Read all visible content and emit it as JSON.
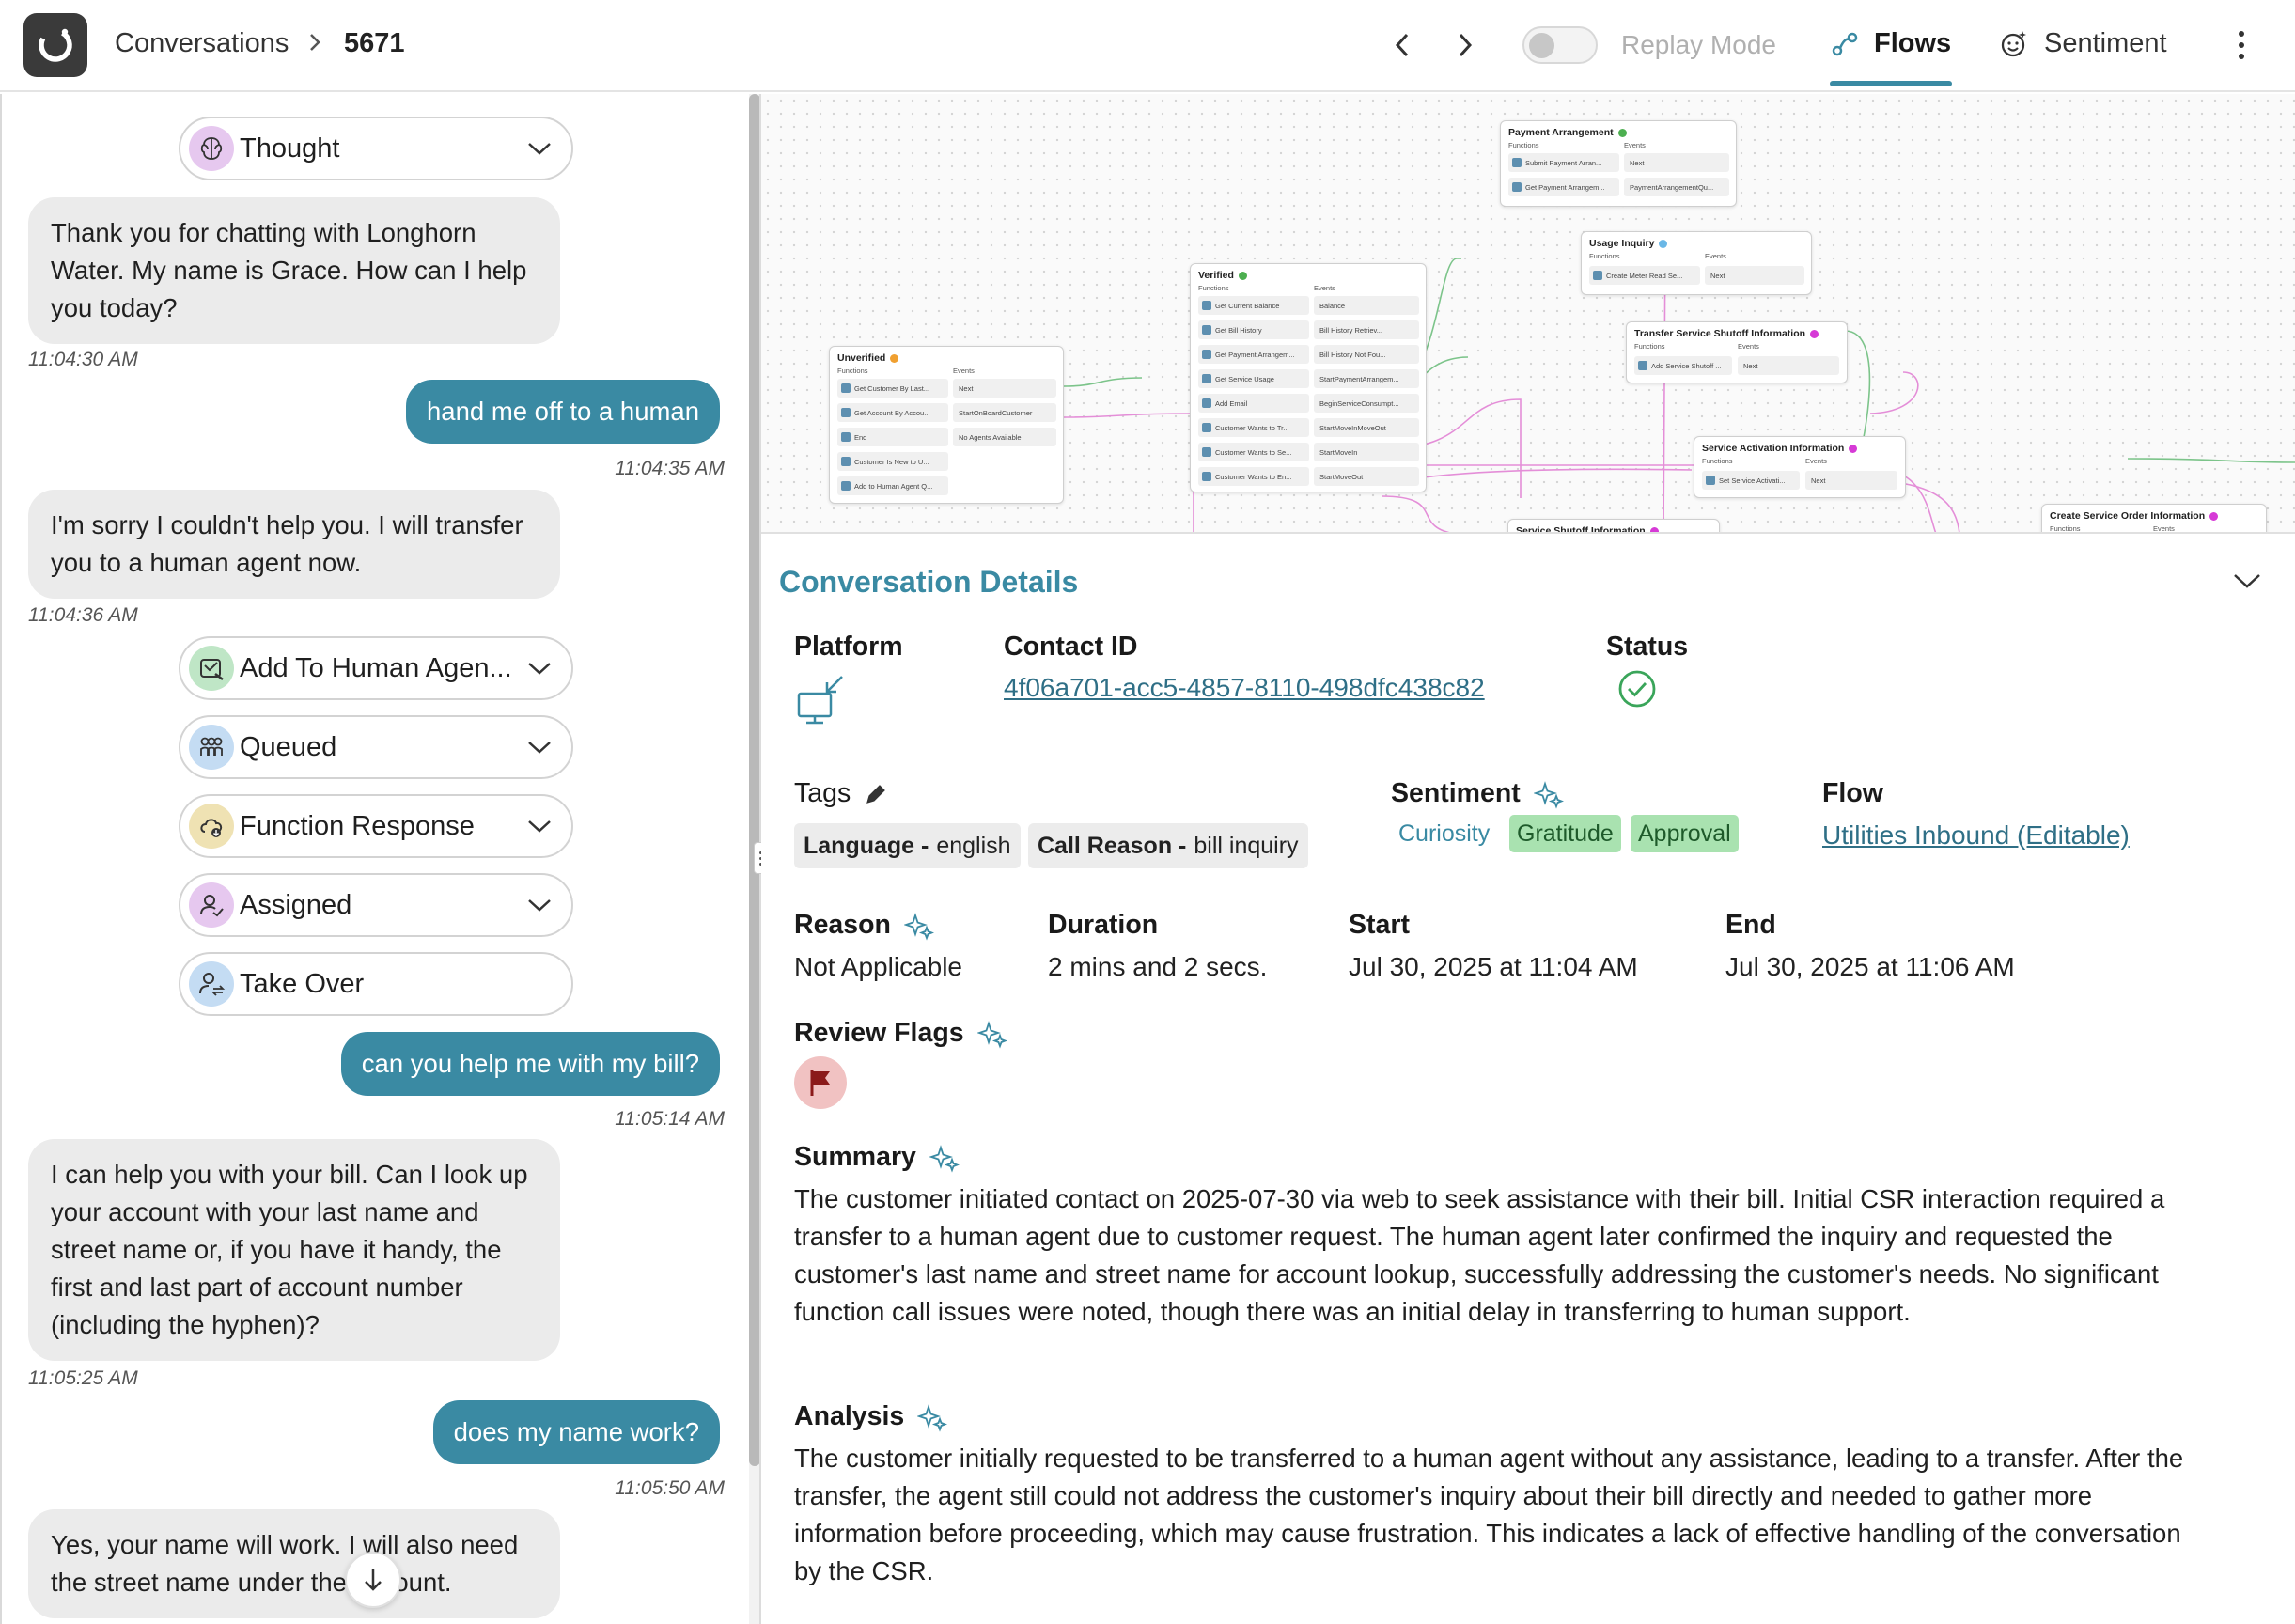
{
  "header": {
    "breadcrumb_root": "Conversations",
    "breadcrumb_id": "5671",
    "replay_label": "Replay Mode",
    "tab_flows": "Flows",
    "tab_sentiment": "Sentiment"
  },
  "chat": {
    "pills": {
      "thought": "Thought",
      "add_to_human": "Add To Human Agen...",
      "queued": "Queued",
      "function_response": "Function Response",
      "assigned": "Assigned",
      "take_over": "Take Over"
    },
    "messages": [
      {
        "role": "bot",
        "text": "Thank you for chatting with Longhorn Water. My name is Grace. How can I help you today?",
        "time": "11:04:30 AM"
      },
      {
        "role": "user",
        "text": "hand me off to a human",
        "time": "11:04:35 AM"
      },
      {
        "role": "bot",
        "text": "I'm sorry I couldn't help you. I will transfer you to a human agent now.",
        "time": "11:04:36 AM"
      },
      {
        "role": "user",
        "text": "can you help me with my bill?",
        "time": "11:05:14 AM"
      },
      {
        "role": "bot",
        "text": "I can help you with your bill. Can I look up your account with your last name and street name or, if you have it handy, the first and last part of account number (including the hyphen)?",
        "time": "11:05:25 AM"
      },
      {
        "role": "user",
        "text": "does my name work?",
        "time": "11:05:50 AM"
      },
      {
        "role": "bot",
        "text": "Yes, your name will work. I will also need the street name under the account.",
        "time": ""
      }
    ]
  },
  "flow": {
    "functions_label": "Functions",
    "events_label": "Events",
    "nodes": {
      "unverified": {
        "title": "Unverified",
        "functions": [
          "Get Customer By Last...",
          "Get Account By Accou...",
          "End",
          "Customer Is New to U...",
          "Add to Human Agent Q..."
        ],
        "events": [
          "Next",
          "StartOnBoardCustomer",
          "No Agents Available"
        ]
      },
      "verified": {
        "title": "Verified",
        "functions": [
          "Get Current Balance",
          "Get Bill History",
          "Get Payment Arrangem...",
          "Get Service Usage",
          "Add Email",
          "Customer Wants to Tr...",
          "Customer Wants to Se...",
          "Customer Wants to En..."
        ],
        "events": [
          "Balance",
          "Bill History Retriev...",
          "Bill History Not Fou...",
          "StartPaymentArrangem...",
          "BeginServiceConsumpt...",
          "StartMoveInMoveOut",
          "StartMoveIn",
          "StartMoveOut"
        ]
      },
      "payment": {
        "title": "Payment Arrangement",
        "functions": [
          "Submit Payment Arran...",
          "Get Payment Arrangem..."
        ],
        "events": [
          "Next",
          "PaymentArrangementQu..."
        ]
      },
      "usage": {
        "title": "Usage Inquiry",
        "functions": [
          "Create Meter Read Se..."
        ],
        "events": [
          "Next"
        ]
      },
      "transfer_shutoff": {
        "title": "Transfer Service Shutoff Information",
        "functions": [
          "Add Service Shutoff ..."
        ],
        "events": [
          "Next"
        ]
      },
      "activation": {
        "title": "Service Activation Information",
        "functions": [
          "Set Service Activati..."
        ],
        "events": [
          "Next"
        ]
      },
      "shutoff": {
        "title": "Service Shutoff Information"
      },
      "create_order": {
        "title": "Create Service Order Information"
      }
    },
    "colors": {
      "unverified": "#f0a030",
      "verified": "#4caf50",
      "payment": "#4caf50",
      "usage": "#6ab7e6",
      "transfer": "#d63ad6",
      "activation": "#d63ad6",
      "edge_green": "#7cc48a",
      "edge_pink": "#e48ed8"
    }
  },
  "details": {
    "title": "Conversation Details",
    "platform_label": "Platform",
    "platform_icon": "web-platform-icon",
    "contact_label": "Contact ID",
    "contact_id": "4f06a701-acc5-4857-8110-498dfc438c82",
    "status_label": "Status",
    "status_icon": "check-circle-icon",
    "tags_label": "Tags",
    "tags": [
      {
        "key": "Language -",
        "value": "english"
      },
      {
        "key": "Call Reason -",
        "value": "bill inquiry"
      }
    ],
    "sentiment_label": "Sentiment",
    "sentiments": [
      {
        "text": "Curiosity",
        "bg": "#ffffff",
        "fg": "#3a8aa3"
      },
      {
        "text": "Gratitude",
        "bg": "#a9e2b0",
        "fg": "#1e5a2a"
      },
      {
        "text": "Approval",
        "bg": "#a9e2b0",
        "fg": "#1e5a2a"
      }
    ],
    "flow_label": "Flow",
    "flow_value": "Utilities Inbound (Editable)",
    "reason_label": "Reason",
    "reason_value": "Not Applicable",
    "duration_label": "Duration",
    "duration_value": "2 mins and 2 secs.",
    "start_label": "Start",
    "start_value": "Jul 30, 2025 at 11:04 AM",
    "end_label": "End",
    "end_value": "Jul 30, 2025 at 11:06 AM",
    "review_flags_label": "Review Flags",
    "summary_label": "Summary",
    "summary_text": "The customer initiated contact on 2025-07-30 via web to seek assistance with their bill. Initial CSR interaction required a transfer to a human agent due to customer request. The human agent later confirmed the inquiry and requested the customer's last name and street name for account lookup, successfully addressing the customer's needs. No significant function call issues were noted, though there was an initial delay in transferring to human support.",
    "analysis_label": "Analysis",
    "analysis_text": "The customer initially requested to be transferred to a human agent without any assistance, leading to a transfer. After the transfer, the agent still could not address the customer's inquiry about their bill directly and needed to gather more information before proceeding, which may cause frustration. This indicates a lack of effective handling of the conversation by the CSR."
  }
}
